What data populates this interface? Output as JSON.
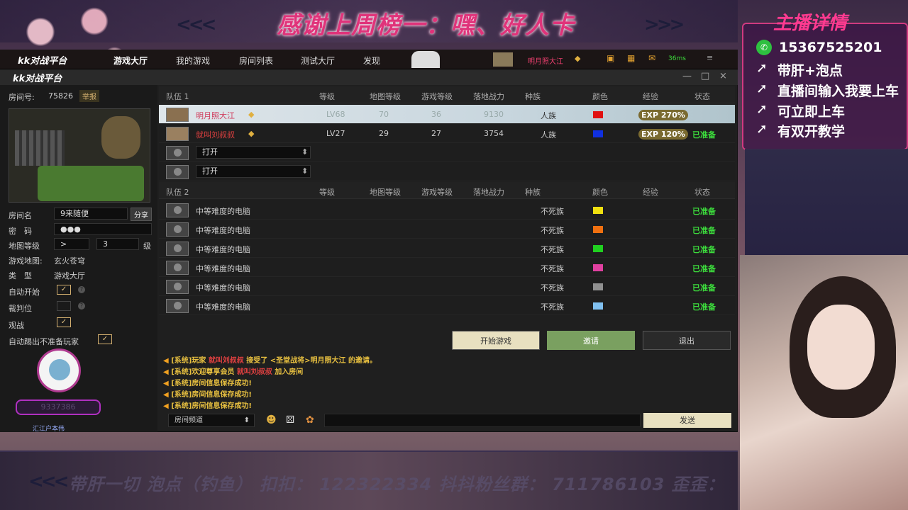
{
  "banner": {
    "title": "感谢上周榜一：嘿、好人卡",
    "chevrons": "<<<"
  },
  "nav": {
    "brand": "kk对战平台",
    "items": [
      "游戏大厅",
      "我的游戏",
      "房间列表",
      "测试大厅",
      "发现"
    ],
    "active_index": 0,
    "user_name": "明月照大江",
    "ping": "36ms"
  },
  "window": {
    "brand": "kk对战平台",
    "min": "—",
    "max": "□",
    "close": "×"
  },
  "room": {
    "id_label": "房间号:",
    "id": "75826",
    "report": "举报",
    "name_label": "房间名",
    "name": "9来随便",
    "share": "分享",
    "pwd_label": "密　码",
    "pwd": "●●●",
    "level_label": "地图等级",
    "level_op": ">",
    "level_val": "3",
    "level_unit": "级",
    "map_label": "游戏地图:",
    "map_name": "玄火苍穹",
    "type_label": "类　型",
    "type_val": "游戏大厅",
    "auto_start": "自动开始",
    "judge": "裁判位",
    "spectate": "观战",
    "auto_kick": "自动踢出不准备玩家",
    "room_owner_id": "9337386",
    "owner_name": "汇江户本伟"
  },
  "table": {
    "team1": "队伍 1",
    "team2": "队伍 2",
    "cols": [
      "等级",
      "地图等级",
      "游戏等级",
      "落地战力",
      "种族",
      "颜色",
      "经验",
      "状态"
    ],
    "team1_rows": [
      {
        "name": "明月照大江",
        "level": "LV68",
        "map_lv": "70",
        "game_lv": "36",
        "power": "9130",
        "race": "人族",
        "color": "#e01010",
        "exp": "EXP 270%",
        "status": ""
      },
      {
        "name": "就叫刘叔叔",
        "level": "LV27",
        "map_lv": "29",
        "game_lv": "27",
        "power": "3754",
        "race": "人族",
        "color": "#1030e0",
        "exp": "EXP 120%",
        "status": "已准备"
      }
    ],
    "open_slots": [
      "打开",
      "打开"
    ],
    "team2_rows": [
      {
        "name": "中等难度的电脑",
        "race": "不死族",
        "color": "#f0e010",
        "status": "已准备"
      },
      {
        "name": "中等难度的电脑",
        "race": "不死族",
        "color": "#f07010",
        "status": "已准备"
      },
      {
        "name": "中等难度的电脑",
        "race": "不死族",
        "color": "#20d020",
        "status": "已准备"
      },
      {
        "name": "中等难度的电脑",
        "race": "不死族",
        "color": "#e040a0",
        "status": "已准备"
      },
      {
        "name": "中等难度的电脑",
        "race": "不死族",
        "color": "#909090",
        "status": "已准备"
      },
      {
        "name": "中等难度的电脑",
        "race": "不死族",
        "color": "#80c0f0",
        "status": "已准备"
      }
    ]
  },
  "buttons": {
    "start": "开始游戏",
    "invite": "邀请",
    "quit": "退出",
    "send": "发送"
  },
  "chat": {
    "messages": [
      {
        "a": "[系统]玩家 ",
        "b": "就叫刘叔叔",
        "c": " 接受了 <圣堂战将>明月照大江 的邀请。"
      },
      {
        "a": "[系统]欢迎尊享会员 ",
        "b": "就叫刘叔叔",
        "c": " 加入房间"
      },
      {
        "a": "[系统]房间信息保存成功!",
        "b": "",
        "c": ""
      },
      {
        "a": "[系统]房间信息保存成功!",
        "b": "",
        "c": ""
      },
      {
        "a": "[系统]房间信息保存成功!",
        "b": "",
        "c": ""
      }
    ],
    "channel": "房间频道"
  },
  "right_panel": {
    "title": "主播详情",
    "phone": "15367525201",
    "lines": [
      "带肝+泡点",
      "直播间输入我要上车",
      "可立即上车",
      "有双开教学"
    ]
  },
  "ticker": {
    "text": "带肝一切 泡点（钓鱼） 扣扣： 122322334 抖抖粉丝群： 711786103 歪歪："
  }
}
